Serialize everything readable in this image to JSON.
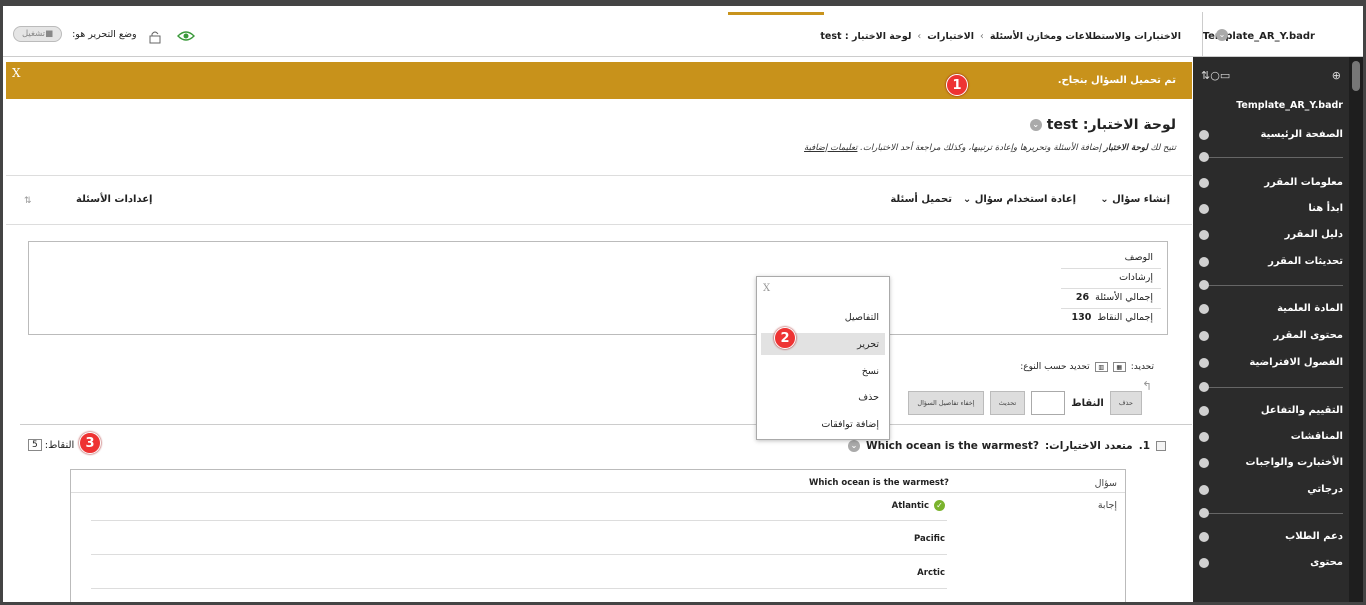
{
  "colors": {
    "accent": "#c8921b",
    "sidebar_bg": "#2b2b2b",
    "callout": "#ee3333",
    "correct": "#7ab32d"
  },
  "topbar": {
    "course_name": "Template_AR_Y.badr",
    "breadcrumbs": [
      "الاختبارات والاستطلاعات ومخازن الأسئلة",
      "الاختبارات",
      "لوحة الاختبار : test"
    ],
    "edit_mode_label": "وضع التحرير هو:",
    "edit_mode_value": "تشغيل",
    "icons": [
      "eye-icon",
      "lock-icon",
      "chevron-down-icon"
    ]
  },
  "sidebar": {
    "course_name": "Template_AR_Y.badr",
    "tool_icons": [
      "add-icon",
      "folder-icon",
      "refresh-icon",
      "sort-icon"
    ],
    "items": [
      "الصفحة الرئيسية",
      "معلومات المقرر",
      "ابدأ هنا",
      "دليل المقرر",
      "تحديثات المقرر",
      "المادة العلمية",
      "محتوى المقرر",
      "الفصول الافتراضية",
      "التقييم والتفاعل",
      "المناقشات",
      "الأختبارت والواجبات",
      "درجاتي",
      "دعم الطلاب",
      "محتوى"
    ]
  },
  "banner": {
    "text": "تم تحميل السؤال بنجاح.",
    "close": "X"
  },
  "callouts": [
    "1",
    "2",
    "3"
  ],
  "page": {
    "title": "لوحة الاختبار: test",
    "desc_prefix": "تتيح لك",
    "desc_bold": "لوحة الاختبار",
    "desc_rest": "إضافة الأسئلة وتحريرها وإعادة ترتيبها، وكذلك مراجعة أحد الاختبارات.",
    "desc_link": "تعليمات إضافية"
  },
  "actions": {
    "create": "إنشاء سؤال",
    "reuse": "إعادة استخدام سؤال",
    "upload": "تحميل أسئلة",
    "settings": "إعدادات الأسئلة"
  },
  "info": {
    "description_label": "الوصف",
    "instructions_label": "إرشادات",
    "total_questions_label": "إجمالي الأسئلة",
    "total_questions": "26",
    "total_points_label": "إجمالي النقاط",
    "total_points": "130"
  },
  "selection": {
    "select_label": "تحديد:",
    "select_by_type": "تحديد حسب النوع:",
    "delete_btn": "حذف",
    "points_label": "النقاط",
    "update_btn": "تحديث",
    "hide_details_btn": "إخفاء تفاصيل السؤال"
  },
  "popup": {
    "close": "X",
    "items": [
      "التفاصيل",
      "تحرير",
      "نسخ",
      "حذف",
      "إضافة توافقات"
    ]
  },
  "question": {
    "number": "1.",
    "type_prefix": "متعدد الاختيارات:",
    "title": "Which ocean is the warmest?",
    "points_label": "النقاط:",
    "points": "5",
    "question_label": "سؤال",
    "question_text": "Which ocean is the warmest?",
    "answer_label": "إجابة",
    "answers": [
      "Atlantic",
      "Pacific",
      "Arctic"
    ]
  }
}
